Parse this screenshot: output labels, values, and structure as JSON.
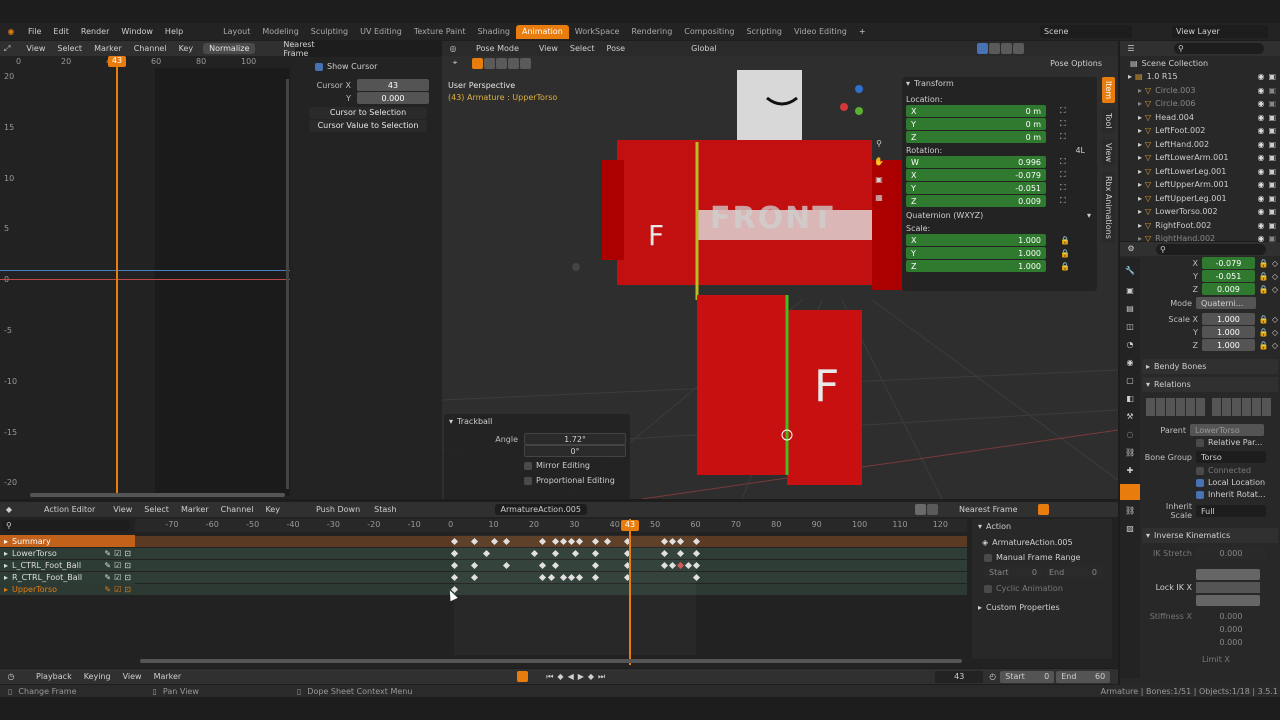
{
  "menu": {
    "items": [
      "File",
      "Edit",
      "Render",
      "Window",
      "Help"
    ],
    "workspaces": [
      "Layout",
      "Modeling",
      "Sculpting",
      "UV Editing",
      "Texture Paint",
      "Shading",
      "Animation",
      "WorkSpace",
      "Rendering",
      "Compositing",
      "Scripting",
      "Video Editing"
    ],
    "active_workspace": "Animation",
    "scene": "Scene",
    "view_layer": "View Layer"
  },
  "graph": {
    "menus": [
      "View",
      "Select",
      "Marker",
      "Channel",
      "Key"
    ],
    "normalize": "Normalize",
    "snap": "Nearest Frame",
    "xticks": [
      "0",
      "20",
      "40",
      "60",
      "80",
      "100"
    ],
    "current": "43",
    "yticks": [
      "20",
      "15",
      "10",
      "5",
      "0",
      "-5",
      "-10",
      "-15",
      "-20"
    ]
  },
  "cursor_panel": {
    "show_cursor": "Show Cursor",
    "cursor_x_label": "Cursor X",
    "cursor_x": "43",
    "y_label": "Y",
    "cursor_y": "0.000",
    "to_selection": "Cursor to Selection",
    "value_to_selection": "Cursor Value to Selection"
  },
  "viewport": {
    "mode": "Pose Mode",
    "menus": [
      "View",
      "Select",
      "Pose"
    ],
    "orientation": "Global",
    "pose_options": "Pose Options",
    "title": "User Perspective",
    "subtitle": "(43) Armature : UpperTorso",
    "front_text": "FRONT",
    "f_letter": "F"
  },
  "transform": {
    "title": "Transform",
    "location_label": "Location:",
    "loc": [
      {
        "axis": "X",
        "value": "0 m"
      },
      {
        "axis": "Y",
        "value": "0 m"
      },
      {
        "axis": "Z",
        "value": "0 m"
      }
    ],
    "rotation_label": "Rotation:",
    "rotation_mode_short": "4L",
    "rot": [
      {
        "axis": "W",
        "value": "0.996"
      },
      {
        "axis": "X",
        "value": "-0.079"
      },
      {
        "axis": "Y",
        "value": "-0.051"
      },
      {
        "axis": "Z",
        "value": "0.009"
      }
    ],
    "rotation_mode": "Quaternion (WXYZ)",
    "scale_label": "Scale:",
    "scale": [
      {
        "axis": "X",
        "value": "1.000"
      },
      {
        "axis": "Y",
        "value": "1.000"
      },
      {
        "axis": "Z",
        "value": "1.000"
      }
    ]
  },
  "side_tabs": [
    "Item",
    "Tool",
    "View",
    "Rbx Animations"
  ],
  "trackball": {
    "title": "Trackball",
    "angle_label": "Angle",
    "angle": "1.72°",
    "angle2": "0°",
    "mirror": "Mirror Editing",
    "proportional": "Proportional Editing"
  },
  "outliner": {
    "title": "Scene Collection",
    "items": [
      {
        "name": "1.0 R15",
        "indent": 0,
        "dim": false
      },
      {
        "name": "Circle.003",
        "indent": 1,
        "dim": true
      },
      {
        "name": "Circle.006",
        "indent": 1,
        "dim": true
      },
      {
        "name": "Head.004",
        "indent": 1,
        "dim": false
      },
      {
        "name": "LeftFoot.002",
        "indent": 1,
        "dim": false
      },
      {
        "name": "LeftHand.002",
        "indent": 1,
        "dim": false
      },
      {
        "name": "LeftLowerArm.001",
        "indent": 1,
        "dim": false
      },
      {
        "name": "LeftLowerLeg.001",
        "indent": 1,
        "dim": false
      },
      {
        "name": "LeftUpperArm.001",
        "indent": 1,
        "dim": false
      },
      {
        "name": "LeftUpperLeg.001",
        "indent": 1,
        "dim": false
      },
      {
        "name": "LowerTorso.002",
        "indent": 1,
        "dim": false
      },
      {
        "name": "RightFoot.002",
        "indent": 1,
        "dim": false
      },
      {
        "name": "RightHand.002",
        "indent": 1,
        "dim": true
      }
    ]
  },
  "props": {
    "rot_rows": [
      {
        "axis": "X",
        "value": "-0.079"
      },
      {
        "axis": "Y",
        "value": "-0.051"
      },
      {
        "axis": "Z",
        "value": "0.009"
      }
    ],
    "mode_label": "Mode",
    "mode": "Quaterni...",
    "scale_label": "Scale X",
    "scale_rows": [
      {
        "axis": "X",
        "value": "1.000"
      },
      {
        "axis": "Y",
        "value": "1.000"
      },
      {
        "axis": "Z",
        "value": "1.000"
      }
    ],
    "bendy": "Bendy Bones",
    "relations": "Relations",
    "parent_label": "Parent",
    "parent": "LowerTorso",
    "relative_parent": "Relative Par...",
    "bone_group_label": "Bone Group",
    "bone_group": "Torso",
    "connected": "Connected",
    "local_location": "Local Location",
    "inherit_rotation": "Inherit Rotat...",
    "inherit_scale_label": "Inherit Scale",
    "inherit_scale": "Full",
    "ik": "Inverse Kinematics",
    "ik_stretch_label": "IK Stretch",
    "ik_stretch": "0.000",
    "lock_ik_label": "Lock IK X",
    "stiffness_label": "Stiffness X",
    "stiffness": [
      "0.000",
      "0.000",
      "0.000"
    ],
    "limit_label": "Limit X"
  },
  "action_editor": {
    "mode": "Action Editor",
    "menus": [
      "View",
      "Select",
      "Marker",
      "Channel",
      "Key"
    ],
    "push_down": "Push Down",
    "stash": "Stash",
    "action": "ArmatureAction.005",
    "snap": "Nearest Frame",
    "ticks": [
      "-70",
      "-60",
      "-50",
      "-40",
      "-30",
      "-20",
      "-10",
      "0",
      "10",
      "20",
      "30",
      "40",
      "50",
      "60",
      "70",
      "80",
      "90",
      "100",
      "110",
      "120"
    ],
    "current": "43",
    "channels": [
      {
        "name": "Summary",
        "type": "summary"
      },
      {
        "name": "LowerTorso",
        "type": "ch"
      },
      {
        "name": "L_CTRL_Foot_Ball",
        "type": "ch"
      },
      {
        "name": "R_CTRL_Foot_Ball",
        "type": "ch"
      },
      {
        "name": "UpperTorso",
        "type": "sel"
      }
    ]
  },
  "action_panel": {
    "title": "Action",
    "action": "ArmatureAction.005",
    "manual_range": "Manual Frame Range",
    "start_label": "Start",
    "start": "0",
    "end_label": "End",
    "end": "0",
    "cyclic": "Cyclic Animation",
    "custom": "Custom Properties"
  },
  "timeline": {
    "menus": [
      "Playback",
      "Keying",
      "View",
      "Marker"
    ],
    "frame": "43",
    "start_label": "Start",
    "start": "0",
    "end_label": "End",
    "end": "60"
  },
  "status": {
    "left": "Change Frame",
    "middle": "Pan View",
    "right_ctx": "Dope Sheet Context Menu",
    "stats": "Armature | Bones:1/51 | Objects:1/18 | 3.5.1"
  }
}
